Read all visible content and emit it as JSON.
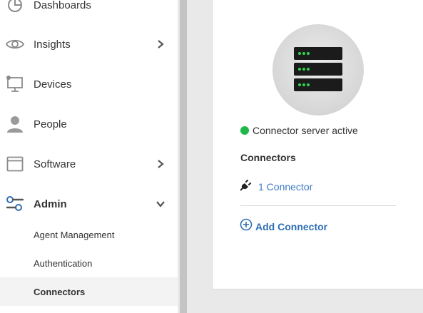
{
  "sidebar": {
    "items": [
      {
        "label": "Dashboards",
        "icon": "dashboard-icon"
      },
      {
        "label": "Insights",
        "icon": "eye-icon",
        "expandable": true
      },
      {
        "label": "Devices",
        "icon": "monitor-icon"
      },
      {
        "label": "People",
        "icon": "person-icon"
      },
      {
        "label": "Software",
        "icon": "window-icon",
        "expandable": true
      },
      {
        "label": "Admin",
        "icon": "sliders-icon",
        "expanded": true
      }
    ],
    "admin_subitems": [
      {
        "label": "Agent Management"
      },
      {
        "label": "Authentication"
      },
      {
        "label": "Connectors",
        "active": true
      }
    ]
  },
  "main": {
    "server_icon": "server-icon",
    "status_text": "Connector server active",
    "status_color": "#1db84a",
    "connectors_heading": "Connectors",
    "connector_count_label": "1 Connector",
    "connector_icon": "plug-icon",
    "add_connector_label": "Add Connector",
    "add_icon": "plus-circle-icon",
    "link_color": "#3f7bc6"
  }
}
